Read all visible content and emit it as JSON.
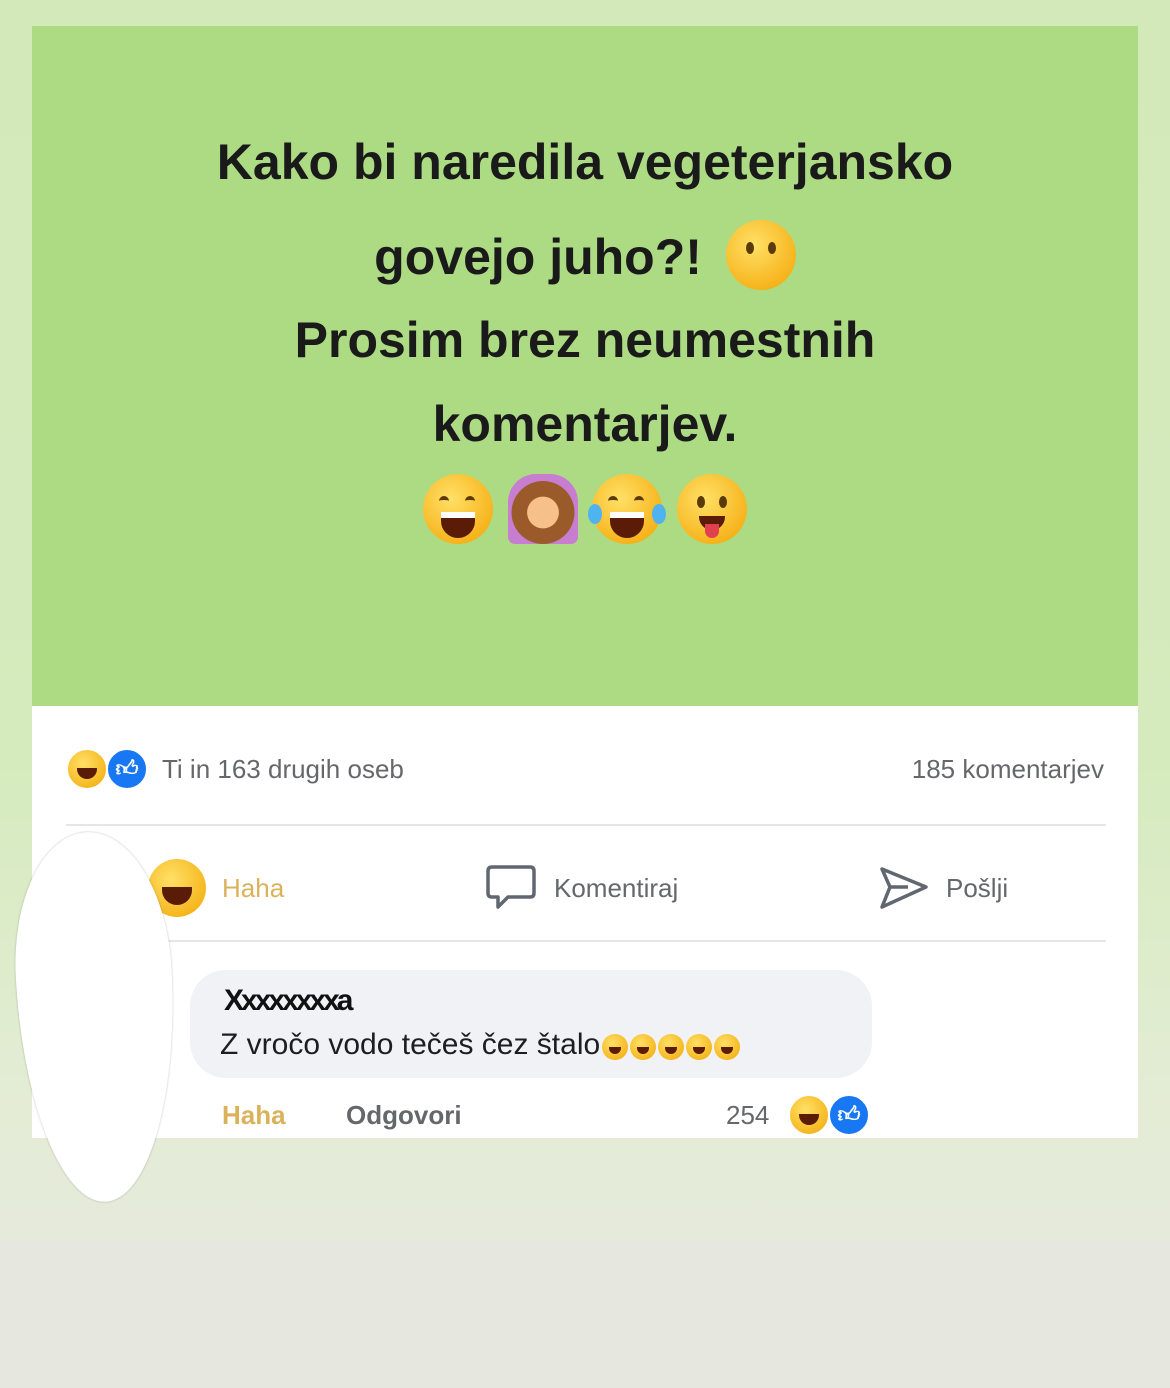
{
  "post": {
    "line1": "Kako bi naredila vegeterjansko",
    "line2": "govejo juho?!",
    "line3": "Prosim brez neumestnih",
    "line4": "komentarjev.",
    "background_color": "#addb83",
    "icons": [
      "thinking-face-icon",
      "grinning-sweat-icon",
      "woman-facepalming-icon",
      "tears-of-joy-icon",
      "tongue-out-face-icon"
    ]
  },
  "reactions": {
    "summary_text": "Ti in 163 drugih oseb",
    "comments_count": "185 komentarjev",
    "icons": [
      "haha-reaction-icon",
      "like-reaction-icon"
    ]
  },
  "actions": {
    "haha_label": "Haha",
    "comment_label": "Komentiraj",
    "send_label": "Pošlji"
  },
  "comment": {
    "author": "Xxxxxxxxa",
    "text": "Z vročo vodo tečeš čez štalo",
    "haha_label": "Haha",
    "reply_label": "Odgovori",
    "reaction_count": "254"
  }
}
